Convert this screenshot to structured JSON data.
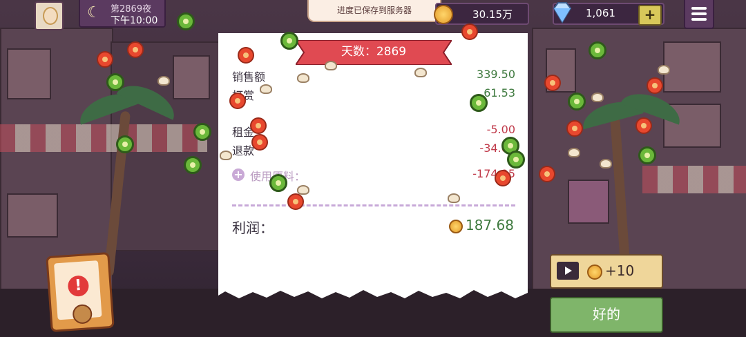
{
  "topbar": {
    "day_label": "第2869夜",
    "time_label": "下午10:00",
    "toast": "进度已保存到服务器",
    "coins": "30.15万",
    "gems": "1,061",
    "gem_plus": "+"
  },
  "receipt": {
    "banner": "天数：2869",
    "rows": [
      {
        "label": "销售额",
        "value": "339.50"
      },
      {
        "label": "打赏",
        "value": "61.53"
      },
      {
        "label": "租金",
        "value": "-5.00"
      },
      {
        "label": "退款",
        "value": "-34.00"
      },
      {
        "label": "使用原料：",
        "value": "-174.25"
      }
    ],
    "profit_label": "利润：",
    "profit_value": "187.68"
  },
  "buttons": {
    "ad_reward": "+10",
    "ok": "好的"
  },
  "colors": {
    "positive": "#3f7a3f",
    "negative": "#c03a4a",
    "banner": "#e04a52",
    "ok_button": "#7fb56a"
  }
}
